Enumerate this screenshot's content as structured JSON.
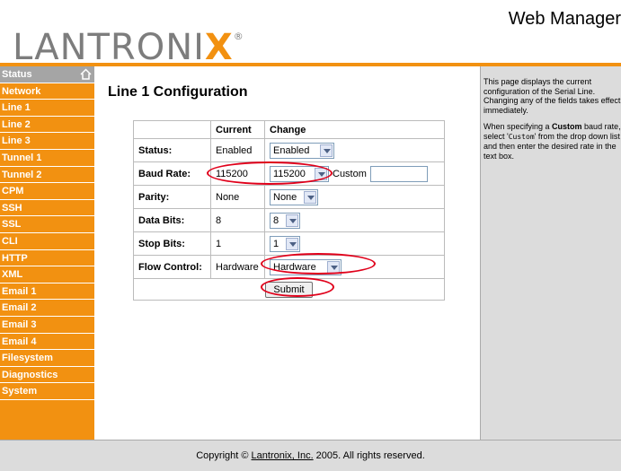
{
  "header": {
    "logo_main": "LANTRONI",
    "logo_x": "X",
    "logo_reg": "®",
    "title": "Web Manager"
  },
  "sidebar": {
    "items": [
      {
        "label": "Status"
      },
      {
        "label": "Network"
      },
      {
        "label": "Line 1"
      },
      {
        "label": "Line 2"
      },
      {
        "label": "Line 3"
      },
      {
        "label": "Tunnel 1"
      },
      {
        "label": "Tunnel 2"
      },
      {
        "label": "CPM"
      },
      {
        "label": "SSH"
      },
      {
        "label": "SSL"
      },
      {
        "label": "CLI"
      },
      {
        "label": "HTTP"
      },
      {
        "label": "XML"
      },
      {
        "label": "Email 1"
      },
      {
        "label": "Email 2"
      },
      {
        "label": "Email 3"
      },
      {
        "label": "Email 4"
      },
      {
        "label": "Filesystem"
      },
      {
        "label": "Diagnostics"
      },
      {
        "label": "System"
      }
    ]
  },
  "main": {
    "title": "Line 1 Configuration",
    "table": {
      "headers": {
        "current": "Current",
        "change": "Change"
      },
      "rows": [
        {
          "label": "Status:",
          "current": "Enabled",
          "change": "Enabled"
        },
        {
          "label": "Baud Rate:",
          "current": "115200",
          "change": "115200",
          "custom_label": "Custom",
          "custom_value": ""
        },
        {
          "label": "Parity:",
          "current": "None",
          "change": "None"
        },
        {
          "label": "Data Bits:",
          "current": "8",
          "change": "8"
        },
        {
          "label": "Stop Bits:",
          "current": "1",
          "change": "1"
        },
        {
          "label": "Flow Control:",
          "current": "Hardware",
          "change": "Hardware"
        }
      ],
      "submit_label": "Submit"
    }
  },
  "help": {
    "para1": "This page displays the current configuration of the Serial Line. Changing any of the fields takes effect immediately.",
    "para2_a": "When specifying a ",
    "para2_bold": "Custom",
    "para2_b": " baud rate, select '",
    "para2_code": "Custom",
    "para2_c": "' from the drop down list and then enter the desired rate in the text box."
  },
  "footer": {
    "prefix": "Copyright © ",
    "link": "Lantronix, Inc.",
    "suffix": " 2005. All rights reserved."
  },
  "colors": {
    "accent_orange": "#f29111",
    "active_nav": "#a5a5a5",
    "panel_gray": "#dcdcdc",
    "annotation_red": "#e0001a"
  }
}
